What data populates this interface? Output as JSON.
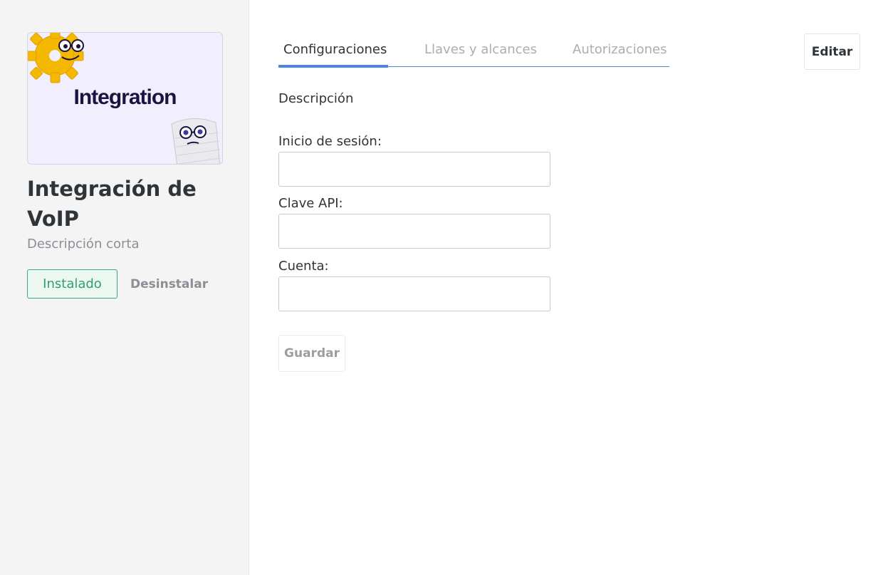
{
  "app": {
    "cover_text": "Integration",
    "name": "Integración de VoIP",
    "short_description": "Descripción corta",
    "installed_label": "Instalado",
    "uninstall_label": "Desinstalar"
  },
  "tabs": [
    {
      "label": "Configuraciones",
      "active": true
    },
    {
      "label": "Llaves y alcances",
      "active": false
    },
    {
      "label": "Autorizaciones",
      "active": false
    }
  ],
  "toolbar": {
    "edit_label": "Editar"
  },
  "form": {
    "section_title": "Descripción",
    "fields": [
      {
        "label": "Inicio de sesión:",
        "value": ""
      },
      {
        "label": "Clave API:",
        "value": ""
      },
      {
        "label": "Cuenta:",
        "value": ""
      }
    ],
    "save_label": "Guardar"
  },
  "colors": {
    "accent": "#4a86e8",
    "installed_green": "#2e9e6f",
    "sidebar_bg": "#f4f4f4",
    "gear_yellow": "#f5b800"
  },
  "icons": [
    "gear-mascot-icon",
    "paper-mascot-icon"
  ]
}
